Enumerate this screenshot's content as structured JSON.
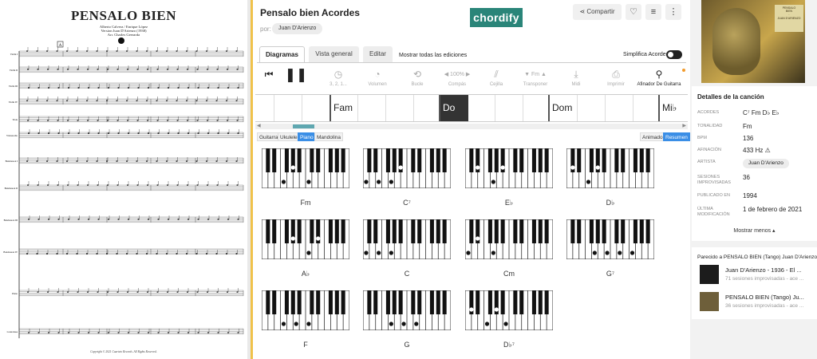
{
  "score": {
    "title": "PENSALO BIEN",
    "composers": "Alberto Calvera / Enrique López",
    "version": "Version Juan D'Arienzo (1938)",
    "arranger": "Arr. Charles Geerarda",
    "rehearsal_mark": "A",
    "staff_labels": [
      "Violin I",
      "Violin II",
      "Violin III",
      "Violin IV",
      "Viola",
      "Violoncello",
      "Bandoneon I",
      "Bandoneon II",
      "Bandoneon III",
      "Bandoneon IV",
      "Piano",
      "Contrabass"
    ],
    "copyright": "Copyright © 2021 Cuarteto Records. All Rights Reserved."
  },
  "header": {
    "song_title": "Pensalo bien Acordes",
    "por_label": "por:",
    "artist": "Juan D'Arienzo",
    "logo": "chordify",
    "share_label": "Compartir",
    "heart_icon": "heart-icon",
    "playlist_icon": "playlist-icon",
    "more_icon": "more-vertical-icon"
  },
  "tabs": {
    "items": [
      "Diagramas",
      "Vista general",
      "Editar"
    ],
    "active": "Diagramas",
    "show_all": "Mostrar todas las ediciones",
    "simplify": "Simplifica Acordes"
  },
  "controls": [
    {
      "icon": "restart-icon",
      "label": ""
    },
    {
      "icon": "pause-icon",
      "label": ""
    },
    {
      "icon": "count-icon",
      "label": "3, 2, 1..."
    },
    {
      "icon": "volume-icon",
      "label": "Volumen"
    },
    {
      "icon": "loop-icon",
      "label": "Bucle"
    },
    {
      "icon": "tempo-icon",
      "label": "Compás",
      "value": "100%"
    },
    {
      "icon": "capo-icon",
      "label": "Cejilla"
    },
    {
      "icon": "transpose-icon",
      "label": "Transponer",
      "value": "Fm"
    },
    {
      "icon": "download-icon",
      "label": "Midi"
    },
    {
      "icon": "print-icon",
      "label": "Imprimir"
    },
    {
      "icon": "tuner-icon",
      "label": "Afinador De Guitarra"
    }
  ],
  "timeline": {
    "chords": [
      "Fam",
      "Do",
      "Dom",
      "Mi♭"
    ],
    "current": "Do"
  },
  "instruments": {
    "items": [
      "Guitarra",
      "Ukulele",
      "Piano",
      "Mandolina"
    ],
    "selected": "Piano",
    "view_modes": [
      "Animado",
      "Resumen"
    ],
    "view_selected": "Resumen"
  },
  "chords": [
    {
      "name": "Fm",
      "notes": [
        5,
        8,
        12
      ]
    },
    {
      "name": "C⁷",
      "notes": [
        0,
        4,
        7,
        10
      ]
    },
    {
      "name": "E♭",
      "notes": [
        3,
        7,
        10
      ]
    },
    {
      "name": "D♭",
      "notes": [
        1,
        5,
        8
      ]
    },
    {
      "name": "A♭",
      "notes": [
        8,
        12,
        15
      ]
    },
    {
      "name": "C",
      "notes": [
        0,
        4,
        7
      ]
    },
    {
      "name": "Cm",
      "notes": [
        0,
        3,
        7
      ]
    },
    {
      "name": "G⁷",
      "notes": [
        7,
        11,
        14,
        17
      ]
    },
    {
      "name": "F",
      "notes": [
        5,
        9,
        12
      ]
    },
    {
      "name": "G",
      "notes": [
        7,
        11,
        14
      ]
    },
    {
      "name": "D♭⁷",
      "notes": [
        1,
        5,
        8,
        11
      ]
    }
  ],
  "details": {
    "heading": "Detalles de la canción",
    "rows": [
      {
        "label": "ACORDES",
        "value": "C⁷  Fm  D♭  E♭"
      },
      {
        "label": "TONALIDAD",
        "value": "Fm"
      },
      {
        "label": "BPM",
        "value": "136"
      },
      {
        "label": "AFINACIÓN",
        "value": "433 Hz ⚠"
      },
      {
        "label": "ARTISTA",
        "value": "Juan D'Arienzo"
      },
      {
        "label": "SESIONES IMPROVISADAS",
        "value": "36"
      },
      {
        "label": "PUBLICADO EN",
        "value": "1994"
      },
      {
        "label": "ÚLTIMA MODIFICACIÓN",
        "value": "1 de febrero de 2021"
      }
    ],
    "show_less": "Mostrar menos ▴"
  },
  "similar": {
    "heading": "Parecido a PENSALO BIEN (Tango) Juan D'Arienzo",
    "items": [
      {
        "title": "Juan D'Arienzo - 1936 - El ...",
        "sub": "71 sesiones improvisadas - ace ..."
      },
      {
        "title": "PENSALO BIEN (Tango) Ju...",
        "sub": "36 sesiones improvisadas - ace ..."
      }
    ]
  },
  "colors": {
    "accent": "#3a8ee6",
    "logo": "#2a8579",
    "divider": "#f0c24a",
    "playhead": "#333333"
  }
}
